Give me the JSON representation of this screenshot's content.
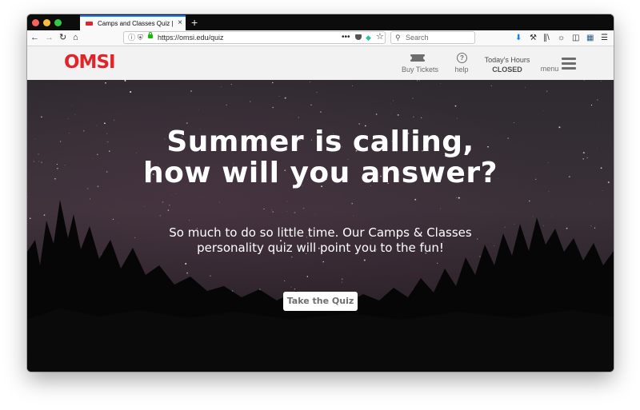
{
  "browser": {
    "tab_title": "Camps and Classes Quiz | OMSI",
    "tab_close": "×",
    "new_tab": "+",
    "url": "https://omsi.edu/quiz",
    "search_placeholder": "Search",
    "icons": [
      "back-icon",
      "forward-icon",
      "reload-icon",
      "home-icon",
      "info-icon",
      "shield-icon",
      "lock-icon",
      "page-actions-icon",
      "pocket-icon",
      "extension-icon",
      "bookmark-star-icon",
      "search-icon",
      "download-icon",
      "tools-icon",
      "library-icon",
      "sync-icon",
      "sidebar-icon",
      "extension-icon",
      "menu-icon"
    ]
  },
  "site": {
    "logo": "OMSI",
    "brand_color": "#e2232a",
    "nav": {
      "buy_tickets": "Buy Tickets",
      "help": "help",
      "help_glyph": "?",
      "hours_label": "Today's Hours",
      "hours_value": "CLOSED",
      "menu": "menu"
    }
  },
  "hero": {
    "title_line1": "Summer is calling,",
    "title_line2": "how will you answer?",
    "subtitle_line1": "So much to do so little time. Our Camps & Classes",
    "subtitle_line2": "personality quiz will point you to the fun!",
    "cta": "Take the Quiz"
  }
}
